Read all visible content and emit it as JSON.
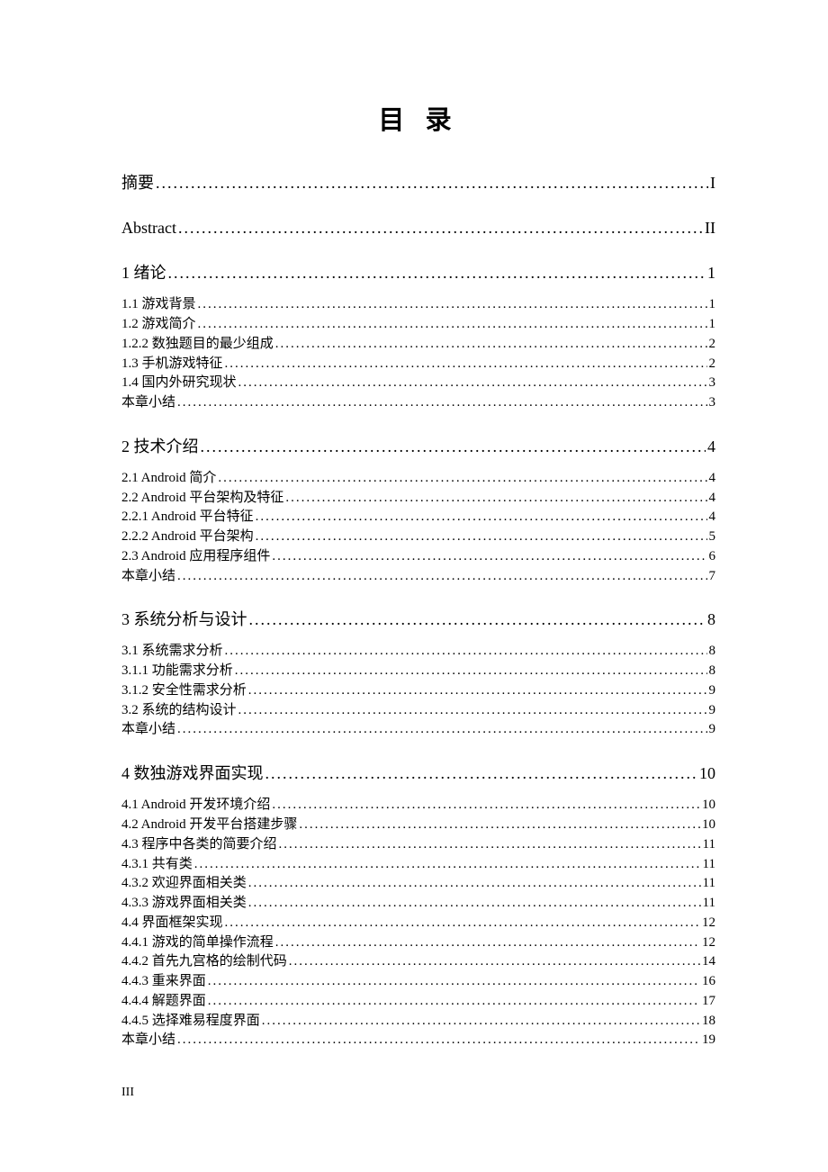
{
  "title": "目 录",
  "page_number": "III",
  "sections": [
    {
      "heading": null,
      "items": [
        {
          "label": "摘要",
          "page": "I",
          "level": 0
        }
      ]
    },
    {
      "heading": null,
      "items": [
        {
          "label": "Abstract",
          "page": "II",
          "level": 0
        }
      ]
    },
    {
      "heading": {
        "label": "1 绪论",
        "page": "1",
        "level": 0
      },
      "items": [
        {
          "label": "1.1 游戏背景",
          "page": "1",
          "level": 1
        },
        {
          "label": "1.2 游戏简介",
          "page": "1",
          "level": 1
        },
        {
          "label": "1.2.2 数独题目的最少组成",
          "page": "2",
          "level": 1
        },
        {
          "label": "1.3 手机游戏特征",
          "page": "2",
          "level": 1
        },
        {
          "label": "1.4 国内外研究现状",
          "page": "3",
          "level": 1
        },
        {
          "label": "本章小结",
          "page": "3",
          "level": 1
        }
      ]
    },
    {
      "heading": {
        "label": "2 技术介绍",
        "page": "4",
        "level": 0
      },
      "items": [
        {
          "label": "2.1 Android 简介",
          "page": "4",
          "level": 1
        },
        {
          "label": "2.2 Android 平台架构及特征",
          "page": "4",
          "level": 1
        },
        {
          "label": "2.2.1 Android 平台特征",
          "page": "4",
          "level": 1
        },
        {
          "label": "2.2.2 Android 平台架构",
          "page": "5",
          "level": 1
        },
        {
          "label": "2.3 Android 应用程序组件",
          "page": "6",
          "level": 1
        },
        {
          "label": "本章小结",
          "page": "7",
          "level": 1
        }
      ]
    },
    {
      "heading": {
        "label": "3 系统分析与设计",
        "page": "8",
        "level": 0
      },
      "items": [
        {
          "label": "3.1 系统需求分析",
          "page": "8",
          "level": 1
        },
        {
          "label": "3.1.1 功能需求分析",
          "page": "8",
          "level": 1
        },
        {
          "label": "3.1.2 安全性需求分析",
          "page": "9",
          "level": 1
        },
        {
          "label": "3.2 系统的结构设计",
          "page": "9",
          "level": 1
        },
        {
          "label": "本章小结",
          "page": "9",
          "level": 1
        }
      ]
    },
    {
      "heading": {
        "label": "4 数独游戏界面实现",
        "page": "10",
        "level": 0
      },
      "items": [
        {
          "label": "4.1 Android 开发环境介绍",
          "page": "10",
          "level": 1
        },
        {
          "label": "4.2 Android 开发平台搭建步骤",
          "page": "10",
          "level": 1
        },
        {
          "label": "4.3 程序中各类的简要介绍",
          "page": "11",
          "level": 1
        },
        {
          "label": "4.3.1 共有类",
          "page": "11",
          "level": 1
        },
        {
          "label": "4.3.2 欢迎界面相关类",
          "page": "11",
          "level": 1
        },
        {
          "label": "4.3.3 游戏界面相关类",
          "page": "11",
          "level": 1
        },
        {
          "label": "4.4 界面框架实现",
          "page": "12",
          "level": 1
        },
        {
          "label": "4.4.1 游戏的简单操作流程",
          "page": "12",
          "level": 1
        },
        {
          "label": "4.4.2 首先九宫格的绘制代码",
          "page": "14",
          "level": 1
        },
        {
          "label": "4.4.3 重来界面",
          "page": "16",
          "level": 1
        },
        {
          "label": "4.4.4 解题界面",
          "page": "17",
          "level": 1
        },
        {
          "label": "4.4.5 选择难易程度界面",
          "page": "18",
          "level": 1
        },
        {
          "label": "本章小结",
          "page": "19",
          "level": 1
        }
      ]
    }
  ]
}
